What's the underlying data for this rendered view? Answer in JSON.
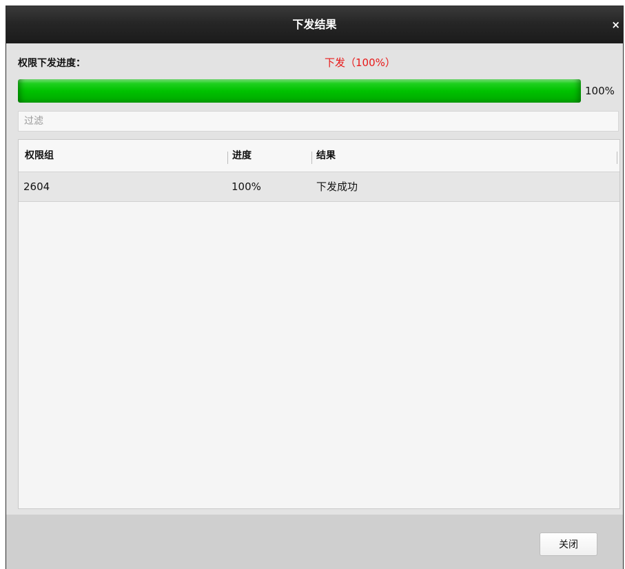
{
  "window": {
    "title": "下发结果",
    "close_glyph": "×"
  },
  "progress": {
    "label": "权限下发进度：",
    "status_text": "下发（100%）",
    "status_color": "#e81818",
    "value": 1.0,
    "percent_text": "100%",
    "bar_color": "#00c200"
  },
  "filter": {
    "placeholder": "过滤",
    "value": ""
  },
  "table": {
    "columns": [
      "权限组",
      "进度",
      "结果"
    ],
    "rows": [
      {
        "group": "2604",
        "progress": "100%",
        "result": "下发成功"
      }
    ]
  },
  "footer": {
    "close_label": "关闭"
  }
}
